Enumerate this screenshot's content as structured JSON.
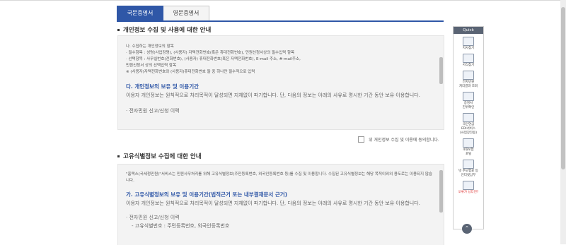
{
  "tabs": [
    {
      "label": "국문증명서",
      "active": true
    },
    {
      "label": "영문증명서",
      "active": false
    }
  ],
  "section1": {
    "title": "개인정보 수집 및 사용에 대한 안내",
    "lines": [
      "나. 수집하는 개인정보의 항목",
      "  · 필수항목 : 성명(사업장명), (사용자) 자택전화번호(혹은 휴대전화번호), 민원신청서상의 필수입력 항목",
      "  · 선택항목 : 사무실번호(전화번호), (사용자) 휴대전화번호(혹은 자택전화번호), E-mail 주소, #-mail주소,",
      "    민원신청서 상의 선택입력 항목",
      "    ※ (사용자)자택전화번호와 (사용자)휴대전화번호 둘 중 하나만 필수적으로 입력"
    ],
    "heading": "다. 개인정보의 보유 및 이용기간",
    "body": "이용자 개인정보는 원칙적으로 처리목적이 달성되면 지체없이 파기합니다. 단, 다음의 정보는 아래의 사유로 명시한 기간 동안 보유·이용합니다.",
    "bullet": "전자민원 신고/신청 이력"
  },
  "agree_label": "위 개인정보 수집 및 이용에 동의합니다.",
  "section2": {
    "title": "고유식별정보 수집에 대한 안내",
    "intro": "\"홈택스(국세청민원)\"서비스는 민원사무처리를 위해 고유식별정보(주민등록번호, 외국인등록번호 등)를 수집 및 이용합니다. 수집된 고유식별정보는 해당 목적이외의 용도로는 이용되지 않습니다.",
    "heading": "가. 고유식별정보의 보유 및 이용기간(법적근거 또는 내부결재문서 근거)",
    "body": "이용자 개인정보는 원칙적으로 처리목적이 달성되면 지체없이 파기합니다. 단, 다음의 정보는 아래의 사유로 명시한 기간 동안 보유·이용합니다.",
    "bullet": "전자민원 신고/신청 이력",
    "sub": "- 고유식별번호 : 주민등록번호, 외국인등록번호"
  },
  "quick": {
    "header": "Quick",
    "items": [
      {
        "label": "지사찾기",
        "icon": "search-branch-icon",
        "red": false
      },
      {
        "label": "서식찾기",
        "icon": "form-search-icon",
        "red": false
      },
      {
        "label": "전자민원\n처리결과 조회",
        "icon": "result-search-icon",
        "red": false
      },
      {
        "label": "증명서\n진위확인",
        "icon": "certificate-icon",
        "red": false
      },
      {
        "label": "국민연금\nEDI서비스\n(사업장전용)",
        "icon": "edi-icon",
        "red": false
      },
      {
        "label": "4대보험\n포털",
        "icon": "insurance-portal-icon",
        "red": false
      },
      {
        "label": "빗 추보험료 등\n인터넷납부",
        "icon": "payment-icon",
        "red": false
      },
      {
        "label": "오류가 났다면?",
        "icon": "error-help-icon",
        "red": true
      }
    ]
  }
}
